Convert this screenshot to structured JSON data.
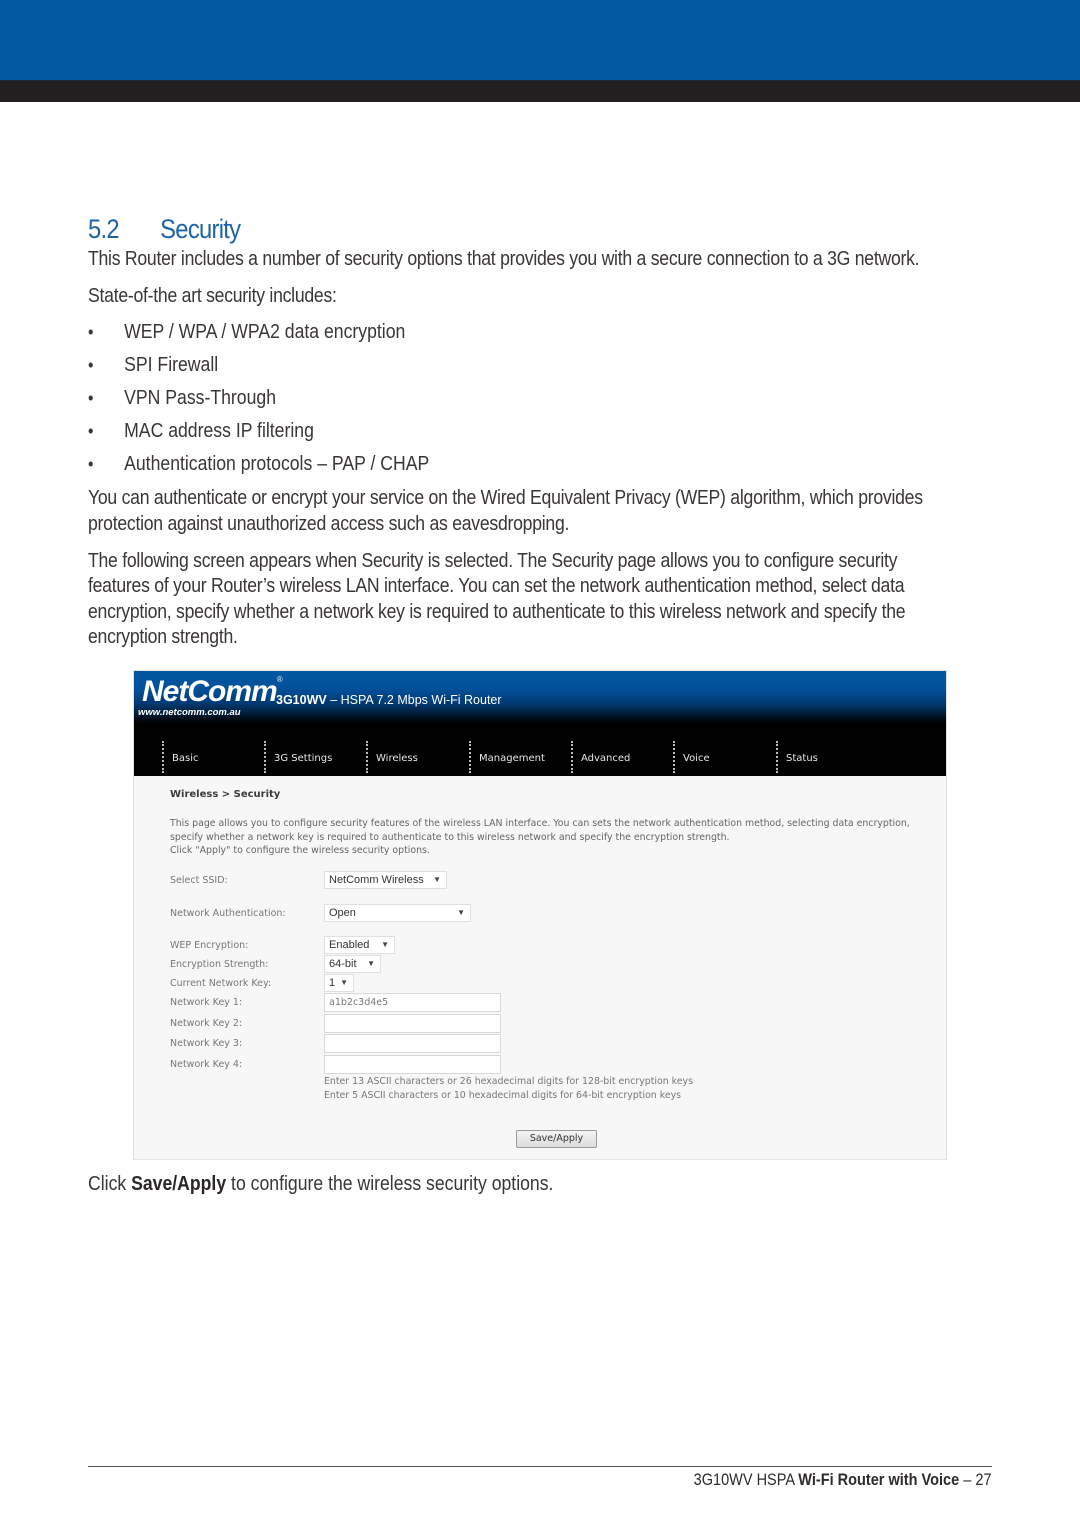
{
  "colors": {
    "brand_blue": "#015aa1",
    "band_dark": "#231f20",
    "heading_blue": "#1c63a8",
    "body_text": "#3a3536"
  },
  "section": {
    "number": "5.2",
    "title": "Security"
  },
  "intro": "This Router includes a number of security options that provides you with a secure connection to a 3G network.",
  "includes_lead": "State-of-the art security includes:",
  "features": [
    "WEP / WPA / WPA2 data encryption",
    "SPI Firewall",
    "VPN Pass-Through",
    "MAC address IP filtering",
    "Authentication protocols – PAP / CHAP"
  ],
  "wep_paragraph": [
    "You can authenticate or encrypt your service on the Wired Equivalent Privacy (WEP) algorithm, which provides",
    "protection against unauthorized access such as eavesdropping."
  ],
  "screen_paragraph": [
    "The following screen appears when Security is selected. The Security page allows you to configure security",
    "features of your Router’s wireless LAN interface. You can set the network authentication method, select data",
    "encryption, specify whether a network key is required to authenticate to this wireless network and specify the",
    "encryption strength."
  ],
  "router_ui": {
    "logo": "NetComm",
    "logo_reg": "®",
    "logo_url": "www.netcomm.com.au",
    "product_model": "3G10WV",
    "product_desc": " – HSPA 7.2 Mbps Wi-Fi Router",
    "nav": [
      "Basic",
      "3G Settings",
      "Wireless",
      "Management",
      "Advanced",
      "Voice",
      "Status"
    ],
    "breadcrumb": "Wireless > Security",
    "description": [
      "This page allows you to configure security features of the wireless LAN interface. You can sets the network authentication method, selecting data encryption,",
      "specify whether a network key is required to authenticate to this wireless network and specify the encryption strength.",
      "Click \"Apply\" to configure the wireless security options."
    ],
    "fields": {
      "ssid": {
        "label": "Select SSID:",
        "value": "NetComm Wireless"
      },
      "auth": {
        "label": "Network Authentication:",
        "value": "Open"
      },
      "wep": {
        "label": "WEP Encryption:",
        "value": "Enabled"
      },
      "strength": {
        "label": "Encryption Strength:",
        "value": "64-bit"
      },
      "current_key": {
        "label": "Current Network Key:",
        "value": "1"
      },
      "key1": {
        "label": "Network Key 1:",
        "value": "a1b2c3d4e5"
      },
      "key2": {
        "label": "Network Key 2:",
        "value": ""
      },
      "key3": {
        "label": "Network Key 3:",
        "value": ""
      },
      "key4": {
        "label": "Network Key 4:",
        "value": ""
      }
    },
    "hints": [
      "Enter 13 ASCII characters or 26 hexadecimal digits for 128-bit encryption keys",
      "Enter 5 ASCII characters or 10 hexadecimal digits for 64-bit encryption keys"
    ],
    "save_label": "Save/Apply",
    "dropdown_icon": "caret-down"
  },
  "caption": {
    "pre": "Click ",
    "bold": "Save/Apply",
    "post": " to configure the wireless security options."
  },
  "footer": {
    "product": "3G10WV HSPA ",
    "product_bold": "Wi-Fi Router with Voice",
    "separator": " – ",
    "page": "27"
  }
}
